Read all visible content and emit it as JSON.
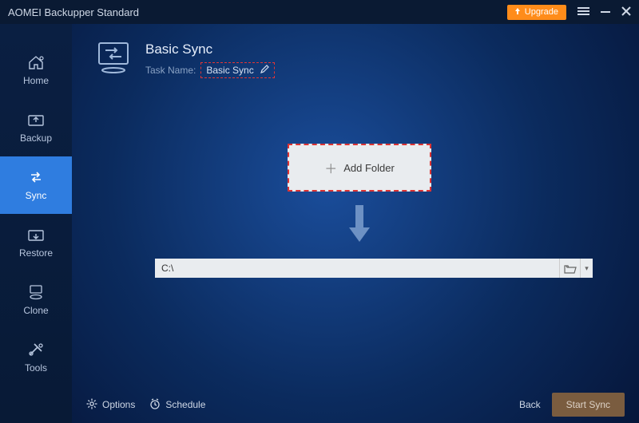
{
  "titlebar": {
    "app_name": "AOMEI Backupper Standard",
    "upgrade_label": "Upgrade"
  },
  "sidebar": {
    "items": [
      {
        "label": "Home"
      },
      {
        "label": "Backup"
      },
      {
        "label": "Sync"
      },
      {
        "label": "Restore"
      },
      {
        "label": "Clone"
      },
      {
        "label": "Tools"
      }
    ]
  },
  "page": {
    "title": "Basic Sync",
    "task_name_label": "Task Name:",
    "task_name_value": "Basic Sync",
    "add_folder_label": "Add Folder",
    "destination_path": "C:\\"
  },
  "footer": {
    "options_label": "Options",
    "schedule_label": "Schedule",
    "back_label": "Back",
    "start_label": "Start Sync"
  }
}
